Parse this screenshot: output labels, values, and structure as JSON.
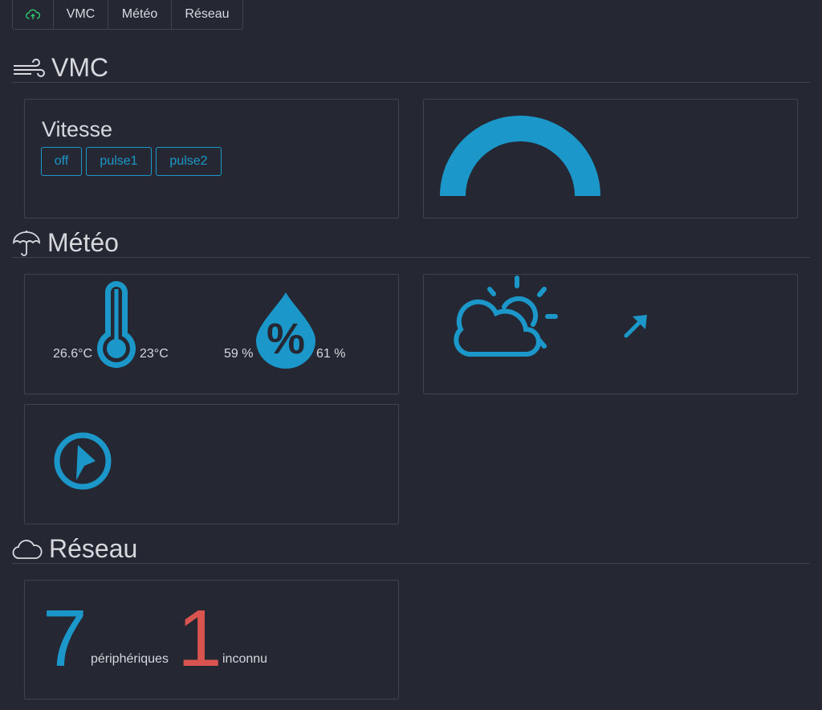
{
  "nav": {
    "items": [
      {
        "icon": "cloud-upload-icon"
      },
      {
        "label": "VMC"
      },
      {
        "label": "Météo"
      },
      {
        "label": "Réseau"
      }
    ]
  },
  "sections": {
    "vmc": {
      "title": "VMC",
      "icon": "wind-icon"
    },
    "meteo": {
      "title": "Météo",
      "icon": "umbrella-icon"
    },
    "reseau": {
      "title": "Réseau",
      "icon": "cloud-icon"
    }
  },
  "vmc": {
    "speed_title": "Vitesse",
    "buttons": [
      "off",
      "pulse1",
      "pulse2"
    ],
    "gauge_value": 1.0
  },
  "meteo": {
    "temp_outdoor": "26.6°C",
    "temp_indoor": "23°C",
    "humidity_outdoor": "59 %",
    "humidity_indoor": "61 %",
    "weather_icon": "partly-cloudy-icon",
    "trend_icon": "arrow-up-right-icon",
    "wind_icon": "compass-icon"
  },
  "reseau": {
    "devices_count": "7",
    "devices_label": "périphériques",
    "unknown_count": "1",
    "unknown_label": "inconnu"
  },
  "colors": {
    "accent": "#1b98c9",
    "danger": "#d9534f",
    "success": "#2ecc71",
    "background": "#252833",
    "border": "#3f434e"
  }
}
